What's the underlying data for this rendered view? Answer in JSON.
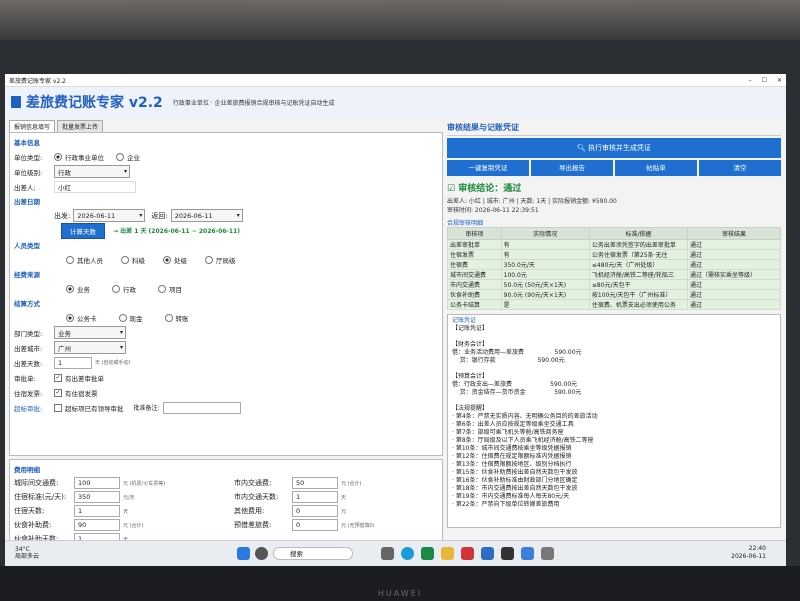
{
  "window": {
    "title": "差旅费记账专家 v2.2"
  },
  "header": {
    "title": "差旅费记账专家 v2.2",
    "subtitle": "行政事业单位 · 企业差旅费报销合规审核与记账凭证自动生成"
  },
  "tabs": [
    "报销信息填写",
    "批量发票上传"
  ],
  "basic": {
    "section_title": "基本信息",
    "unit_type_label": "单位类型:",
    "unit_type_options": [
      "行政事业单位",
      "企业"
    ],
    "level_label": "单位级别:",
    "level_value": "行政",
    "traveler_label": "出差人:",
    "traveler_value": "小红"
  },
  "dates": {
    "section_title": "出差日期",
    "depart_label": "出发:",
    "depart_value": "2026-06-11",
    "return_label": "返回:",
    "return_value": "2026-06-11",
    "calc_button": "计算天数",
    "result": "→ 出差 1 天 (2026-06-11 ~ 2026-06-11)"
  },
  "person": {
    "section_title": "人员类型",
    "options": [
      "其他人员",
      "科级",
      "处级",
      "厅局级"
    ]
  },
  "source": {
    "section_title": "经费来源",
    "options": [
      "业务",
      "行政",
      "项目"
    ]
  },
  "payment": {
    "section_title": "结算方式",
    "options": [
      "公务卡",
      "现金",
      "转账"
    ]
  },
  "details": {
    "dept_label": "部门类型:",
    "dept_value": "业务",
    "city_label": "出差城市:",
    "city_value": "广州",
    "days_label": "出差天数:",
    "days_value": "1",
    "days_hint": "天 (自动或手动)",
    "approval_label": "审批单:",
    "approval_check": "有出差审批单",
    "invoice_label": "住宿发票:",
    "invoice_check": "有住宿发票",
    "over_label": "超标审批:",
    "over_check": "超标项已有领导审批",
    "note_label": "批准备注:"
  },
  "expense": {
    "section_title": "费用明细",
    "left": [
      {
        "label": "城际间交通费:",
        "value": "100",
        "hint": "元 (机票/火车票等)"
      },
      {
        "label": "住宿标准(元/天):",
        "value": "350",
        "hint": "元/天"
      },
      {
        "label": "住宿天数:",
        "value": "1",
        "hint": "天"
      },
      {
        "label": "伙食补助费:",
        "value": "90",
        "hint": "元 (合计)"
      },
      {
        "label": "伙食补助天数:",
        "value": "1",
        "hint": "天"
      }
    ],
    "right": [
      {
        "label": "市内交通费:",
        "value": "50",
        "hint": "元 (合计)"
      },
      {
        "label": "市内交通天数:",
        "value": "1",
        "hint": "天"
      },
      {
        "label": "其他费用:",
        "value": "0",
        "hint": "元"
      },
      {
        "label": "预借差旅费:",
        "value": "0",
        "hint": "元 (无预借填0)"
      }
    ]
  },
  "review": {
    "title": "审核结果与记账凭证",
    "execute_button": "执行审核并生成凭证",
    "actions": [
      "一键复制凭证",
      "导出报告",
      "帖贴单",
      "清空"
    ],
    "verdict": "审核结论：通过",
    "info_line1": "出差人: 小红 | 城市: 广州 | 天数: 1天 | 实际报销金额: ¥590.00",
    "info_line2": "审核时间: 2026-06-11 22:39:51",
    "table_title": "合规审核明细",
    "columns": [
      "审核项",
      "实际情况",
      "标准/依据",
      "审核结果"
    ],
    "rows": [
      [
        "出差审批单",
        "有",
        "公务出差须凭签字的出差审批单",
        "通过"
      ],
      [
        "住宿发票",
        "有",
        "公务住宿发票（第25条·无住",
        "通过"
      ],
      [
        "住宿费",
        "350.0元/天",
        "≤480元/天（广州处级）",
        "通过"
      ],
      [
        "城市间交通费",
        "100.0元",
        "飞机经济舱/高铁二等座/轮船三",
        "通过（需核实乘坐等级）"
      ],
      [
        "市内交通费",
        "50.0元 (50元/天×1天)",
        "≤80元/天包干",
        "通过"
      ],
      [
        "伙食补助费",
        "90.0元 (90元/天×1天)",
        "按100元/天包干（广州标准）",
        "通过"
      ],
      [
        "公务卡结算",
        "是",
        "住宿费、机票支出必须使用公务",
        "通过"
      ]
    ]
  },
  "voucher": {
    "title": "记账凭证",
    "lines": [
      "【记账凭证】",
      "",
      "【财务会计】",
      "借：业务活动费用—差旅费                590.00元",
      "    贷：银行存款                      590.00元",
      "",
      "【预算会计】",
      "借：行政支出—差旅费                    590.00元",
      "    贷：资金结存—货币资金               590.00元",
      "",
      "【法规提醒】",
      "· 第4条：严禁无实质内容、无明确公务目的的差旅活动",
      "· 第6条：出差人员应按规定等级乘坐交通工具",
      "· 第7条：部级可乘飞机头等舱/高铁商务座",
      "· 第8条：厅局级及以下人员乘飞机经济舱/高铁二等座",
      "· 第10条：城市间交通费按乘坐等级凭据报销",
      "· 第12条：住宿费在规定限额标准内凭据报销",
      "· 第13条：住宿费限额按地区、级别分档执行",
      "· 第15条：伙食补助费按出差自然天数包干发放",
      "· 第16条：伙食补助标准由财政部门分地区确定",
      "· 第18条：市内交通费按出差自然天数包干发放",
      "· 第19条：市内交通费标准每人每天80元/天",
      "· 第22条：严禁向下级单位转嫁差旅费用"
    ]
  },
  "taskbar": {
    "weather_temp": "34°C",
    "weather_desc": "局部多云",
    "search_placeholder": "搜索",
    "time": "22:40",
    "date": "2026-06-11"
  },
  "device": {
    "brand": "HUAWEI"
  }
}
